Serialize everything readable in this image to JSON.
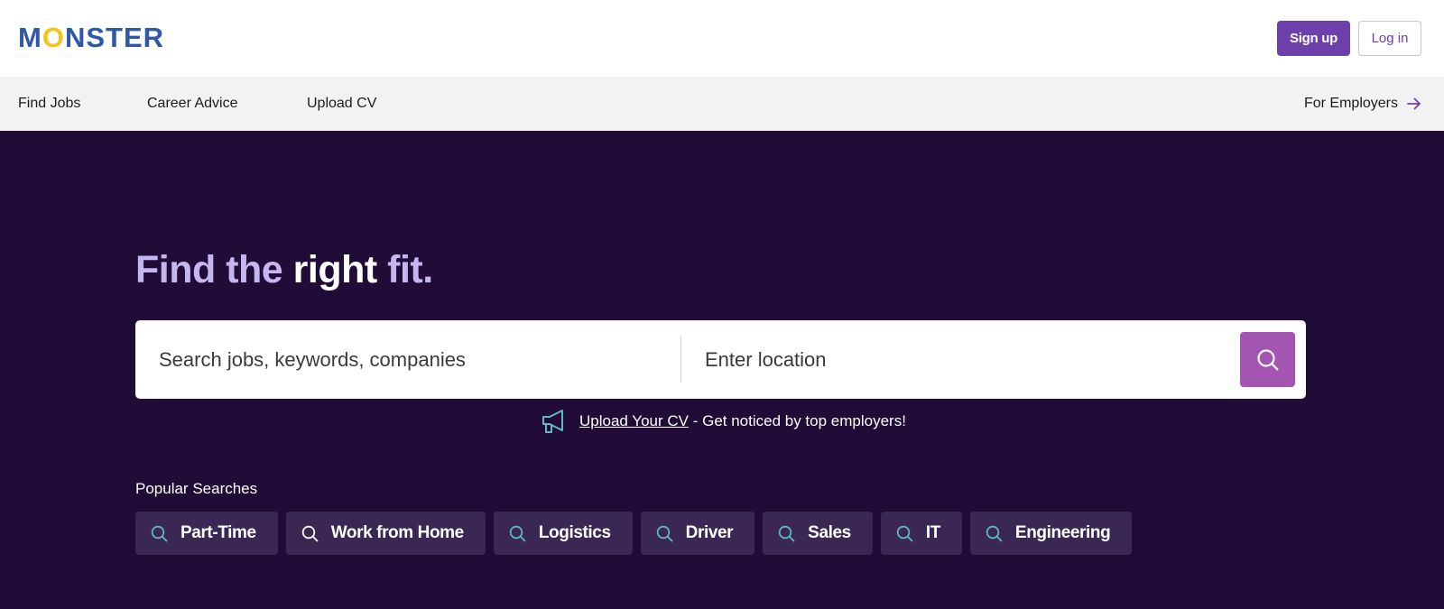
{
  "header": {
    "logo": {
      "m": "M",
      "o": "O",
      "rest": "NSTER"
    },
    "signup_label": "Sign up",
    "login_label": "Log in"
  },
  "nav": {
    "items": [
      {
        "label": "Find Jobs"
      },
      {
        "label": "Career Advice"
      },
      {
        "label": "Upload CV"
      }
    ],
    "employers_label": "For Employers",
    "employers_icon": "arrow-right-icon"
  },
  "hero": {
    "title_part1": "Find the",
    "title_part2": "right",
    "title_part3": "fit.",
    "colors": {
      "background": "#200c36",
      "title_light": "#c5b6f0",
      "accent": "#6d3fab",
      "search_button": "#a355b1",
      "chip_background": "#3a2754",
      "chip_icon": "#5fb8c4"
    }
  },
  "search": {
    "keyword_placeholder": "Search jobs, keywords, companies",
    "location_placeholder": "Enter location",
    "button_icon": "search-icon"
  },
  "upload_promo": {
    "icon": "megaphone-icon",
    "link_text": "Upload Your CV",
    "text": " - Get noticed by top employers!"
  },
  "popular": {
    "label": "Popular Searches",
    "chips": [
      {
        "label": "Part-Time"
      },
      {
        "label": "Work from Home"
      },
      {
        "label": "Logistics"
      },
      {
        "label": "Driver"
      },
      {
        "label": "Sales"
      },
      {
        "label": "IT"
      },
      {
        "label": "Engineering"
      }
    ]
  }
}
